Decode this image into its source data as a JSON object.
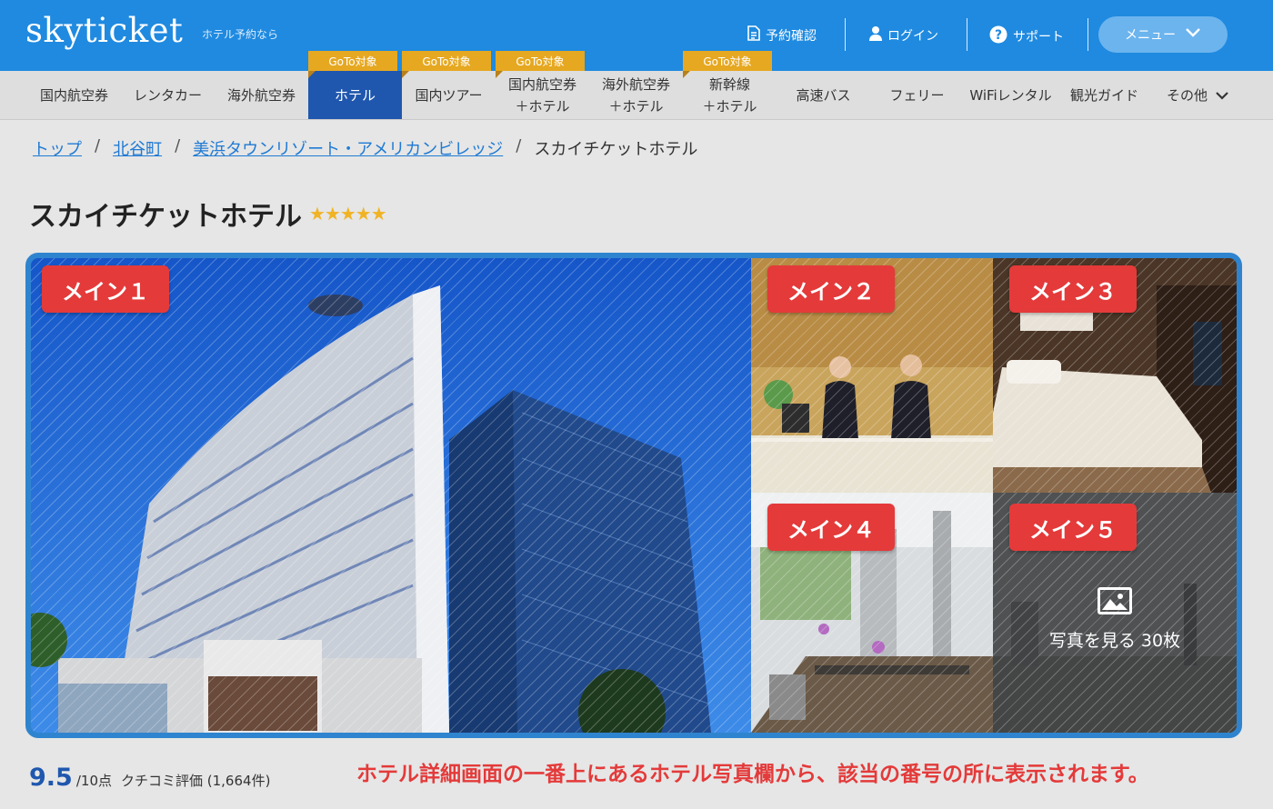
{
  "header": {
    "logo": "skyticket",
    "tagline": "ホテル予約なら",
    "links": [
      "予約確認",
      "ログイン",
      "サポート"
    ],
    "menu_label": "メニュー"
  },
  "nav": {
    "items": [
      {
        "label": "国内航空券",
        "goto": ""
      },
      {
        "label": "レンタカー",
        "goto": ""
      },
      {
        "label": "海外航空券",
        "goto": ""
      },
      {
        "label": "ホテル",
        "goto": "GoTo対象",
        "active": true
      },
      {
        "label": "国内ツアー",
        "goto": "GoTo対象"
      },
      {
        "label": "国内航空券\n＋ホテル",
        "goto": "GoTo対象"
      },
      {
        "label": "海外航空券\n＋ホテル",
        "goto": ""
      },
      {
        "label": "新幹線\n＋ホテル",
        "goto": "GoTo対象"
      },
      {
        "label": "高速バス",
        "goto": ""
      },
      {
        "label": "フェリー",
        "goto": ""
      },
      {
        "label": "WiFiレンタル",
        "goto": ""
      },
      {
        "label": "観光ガイド",
        "goto": ""
      },
      {
        "label": "その他",
        "goto": ""
      }
    ]
  },
  "breadcrumb": [
    "トップ",
    "北谷町",
    "美浜タウンリゾート・アメリカンビレッジ",
    "スカイチケットホテル"
  ],
  "hotel": {
    "name": "スカイチケットホテル",
    "stars": "★★★★★"
  },
  "gallery": {
    "badges": [
      "メイン１",
      "メイン２",
      "メイン３",
      "メイン４",
      "メイン５"
    ],
    "more_label": "写真を見る 30枚"
  },
  "rating": {
    "score": "9.5",
    "max": "/10点",
    "label": "クチコミ評価 (1,664件)"
  },
  "note": "ホテル詳細画面の一番上にあるホテル写真欄から、該当の番号の所に表示されます。",
  "colors": {
    "header": "#1f8ae0",
    "active_tab": "#1f57ae",
    "goto": "#e6a821",
    "badge": "#e43a3a",
    "link": "#1f7ad4"
  }
}
